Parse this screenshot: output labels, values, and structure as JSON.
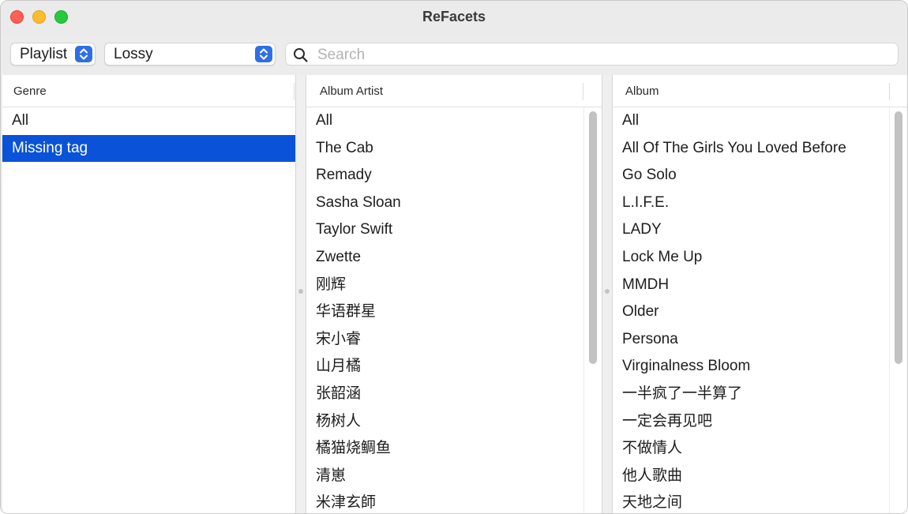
{
  "window": {
    "title": "ReFacets"
  },
  "toolbar": {
    "source_popup": {
      "value": "Playlist"
    },
    "playlist_popup": {
      "value": "Lossy"
    },
    "search": {
      "placeholder": "Search",
      "value": ""
    }
  },
  "genre": {
    "header": "Genre",
    "items": [
      "All",
      "Missing tag"
    ],
    "selected_index": 1
  },
  "album_artist": {
    "header": "Album Artist",
    "items": [
      "All",
      "The Cab",
      "Remady",
      "Sasha Sloan",
      "Taylor Swift",
      "Zwette",
      "刚辉",
      "华语群星",
      "宋小睿",
      "山月橘",
      "张韶涵",
      "杨树人",
      "橘猫烧鲷鱼",
      "清崽",
      "米津玄師"
    ]
  },
  "album": {
    "header": "Album",
    "items": [
      "All",
      "All Of The Girls You Loved Before",
      "Go Solo",
      "L.I.F.E.",
      "LADY",
      "Lock Me Up",
      "MMDH",
      "Older",
      "Persona",
      "Virginalness Bloom",
      "一半疯了一半算了",
      "一定会再见吧",
      "不做情人",
      "他人歌曲",
      "天地之间"
    ]
  },
  "colors": {
    "selection": "#0a53d8",
    "accent": "#2f6fe4"
  },
  "icons": {
    "search": "magnifier-icon",
    "popup_stepper": "up-down-chevron-icon"
  }
}
